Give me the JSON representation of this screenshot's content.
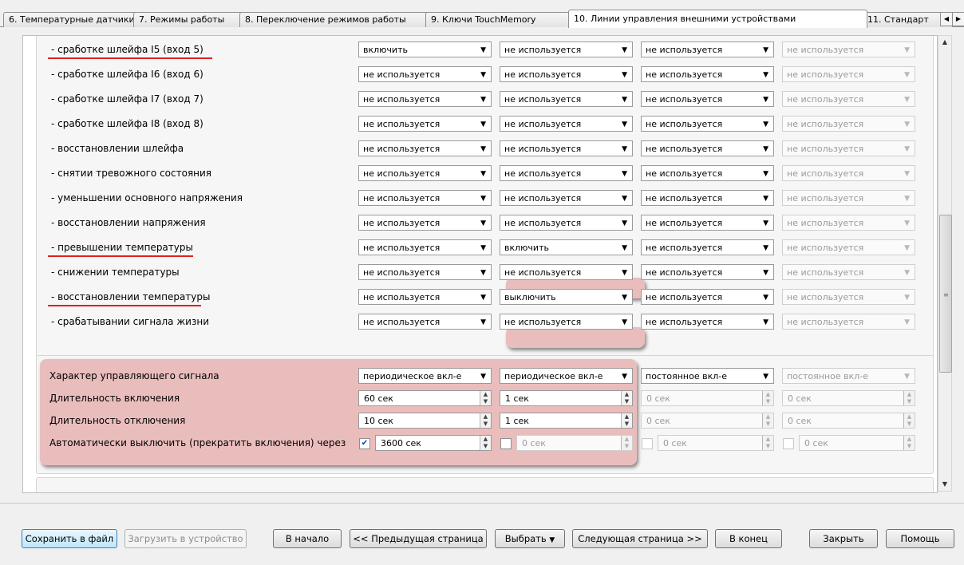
{
  "tabs": [
    {
      "label": "6. Температурные датчики"
    },
    {
      "label": "7. Режимы работы"
    },
    {
      "label": "8. Переключение режимов работы"
    },
    {
      "label": "9. Ключи TouchMemory"
    },
    {
      "label": "10. Линии управления внешними устройствами"
    },
    {
      "label": "11. Стандарт"
    }
  ],
  "events": [
    {
      "label": "- сработке шлейфа I5 (вход 5)",
      "c1": "включить",
      "c2": "не используется",
      "c3": "не используется",
      "c4": "не используется"
    },
    {
      "label": "- сработке шлейфа I6 (вход 6)",
      "c1": "не используется",
      "c2": "не используется",
      "c3": "не используется",
      "c4": "не используется"
    },
    {
      "label": "- сработке шлейфа I7 (вход 7)",
      "c1": "не используется",
      "c2": "не используется",
      "c3": "не используется",
      "c4": "не используется"
    },
    {
      "label": "- сработке шлейфа I8 (вход 8)",
      "c1": "не используется",
      "c2": "не используется",
      "c3": "не используется",
      "c4": "не используется"
    },
    {
      "label": "- восстановлении шлейфа",
      "c1": "не используется",
      "c2": "не используется",
      "c3": "не используется",
      "c4": "не используется"
    },
    {
      "label": "- снятии тревожного состояния",
      "c1": "не используется",
      "c2": "не используется",
      "c3": "не используется",
      "c4": "не используется"
    },
    {
      "label": "- уменьшении основного напряжения",
      "c1": "не используется",
      "c2": "не используется",
      "c3": "не используется",
      "c4": "не используется"
    },
    {
      "label": "- восстановлении напряжения",
      "c1": "не используется",
      "c2": "не используется",
      "c3": "не используется",
      "c4": "не используется"
    },
    {
      "label": "- превышении температуры",
      "c1": "не используется",
      "c2": "включить",
      "c3": "не используется",
      "c4": "не используется"
    },
    {
      "label": "- снижении температуры",
      "c1": "не используется",
      "c2": "не используется",
      "c3": "не используется",
      "c4": "не используется"
    },
    {
      "label": "- восстановлении температуры",
      "c1": "не используется",
      "c2": "выключить",
      "c3": "не используется",
      "c4": "не используется"
    },
    {
      "label": "- срабатывании сигнала жизни",
      "c1": "не используется",
      "c2": "не используется",
      "c3": "не используется",
      "c4": "не используется"
    }
  ],
  "signal": {
    "type_label": "Характер управляющего сигнала",
    "type_values": [
      "периодическое вкл-е",
      "периодическое вкл-е",
      "постоянное вкл-е",
      "постоянное вкл-е"
    ],
    "on_label": "Длительность включения",
    "on_values": [
      "60 сек",
      "1 сек",
      "0 сек",
      "0 сек"
    ],
    "off_label": "Длительность отключения",
    "off_values": [
      "10 сек",
      "1 сек",
      "0 сек",
      "0 сек"
    ],
    "auto_label": "Автоматически выключить (прекратить включения) через",
    "auto_values": [
      "3600 сек",
      "0 сек",
      "0 сек",
      "0 сек"
    ],
    "auto_checked": [
      "✔",
      "",
      "",
      ""
    ]
  },
  "buttons": {
    "save": "Сохранить в файл",
    "load": "Загрузить в устройство",
    "first": "В начало",
    "prev": "<< Предыдущая страница",
    "select": "Выбрать",
    "next": "Следующая страница >>",
    "last": "В конец",
    "close": "Закрыть",
    "help": "Помощь"
  },
  "colors": {
    "accent_red": "#e02020",
    "highlight": "#dc7878"
  }
}
